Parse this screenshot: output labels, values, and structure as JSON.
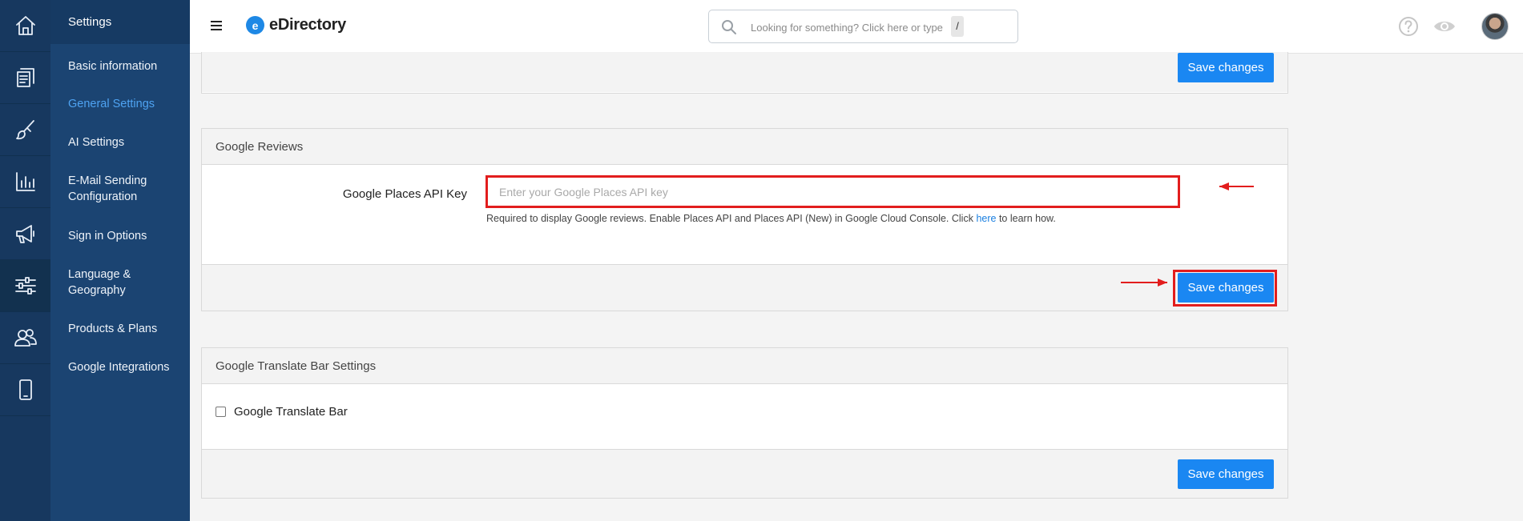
{
  "app": {
    "name": "eDirectory"
  },
  "rail": {
    "items": [
      {
        "icon": "home-icon"
      },
      {
        "icon": "content-icon"
      },
      {
        "icon": "design-icon"
      },
      {
        "icon": "reports-icon"
      },
      {
        "icon": "promote-icon"
      },
      {
        "icon": "settings-sliders-icon",
        "active": true
      },
      {
        "icon": "users-icon"
      },
      {
        "icon": "mobile-icon"
      }
    ]
  },
  "submenu": {
    "title": "Settings",
    "items": [
      {
        "label": "Basic information"
      },
      {
        "label": "General Settings",
        "active": true
      },
      {
        "label": "AI Settings"
      },
      {
        "label": "E-Mail Sending Configuration"
      },
      {
        "label": "Sign in Options"
      },
      {
        "label": "Language & Geography"
      },
      {
        "label": "Products & Plans"
      },
      {
        "label": "Google Integrations"
      }
    ]
  },
  "search": {
    "placeholder": "Looking for something? Click here or type",
    "shortcut": "/"
  },
  "top_panel": {
    "save_label": "Save changes"
  },
  "google_reviews": {
    "title": "Google Reviews",
    "field_label": "Google Places API Key",
    "input_value": "",
    "input_placeholder": "Enter your Google Places API key",
    "help_before": "Required to display Google reviews. Enable Places API and Places API (New) in Google Cloud Console. Click",
    "help_link": "here",
    "help_after": "to learn how.",
    "save_label": "Save changes"
  },
  "translate_bar": {
    "title": "Google Translate Bar Settings",
    "checkbox_label": "Google Translate Bar",
    "checked": false,
    "save_label": "Save changes"
  },
  "colors": {
    "rail": "#17385f",
    "submenu": "#1b4472",
    "accent": "#1a87f2",
    "annotation": "#e21d1d"
  }
}
